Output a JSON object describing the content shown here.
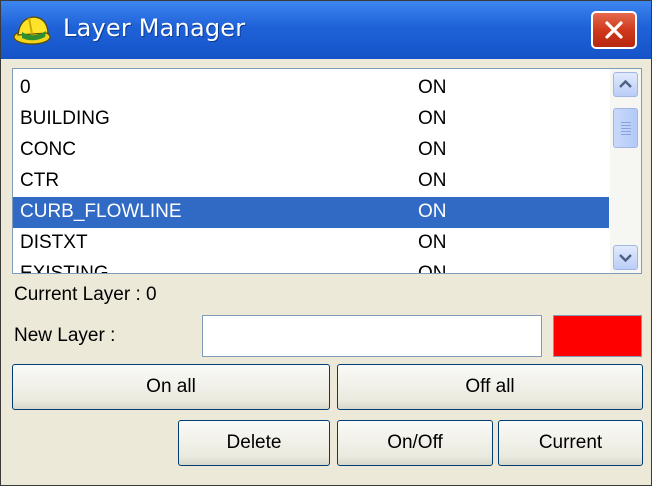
{
  "window": {
    "title": "Layer Manager",
    "icons": {
      "app": "hardhat-icon",
      "close": "close-icon"
    }
  },
  "layers": [
    {
      "name": "0",
      "state": "ON",
      "selected": false
    },
    {
      "name": "BUILDING",
      "state": "ON",
      "selected": false
    },
    {
      "name": "CONC",
      "state": "ON",
      "selected": false
    },
    {
      "name": "CTR",
      "state": "ON",
      "selected": false
    },
    {
      "name": "CURB_FLOWLINE",
      "state": "ON",
      "selected": true
    },
    {
      "name": "DISTXT",
      "state": "ON",
      "selected": false
    },
    {
      "name": "EXISTING",
      "state": "ON",
      "selected": false
    }
  ],
  "current_layer": {
    "label": "Current Layer :",
    "value": "0"
  },
  "new_layer": {
    "label": "New Layer :",
    "value": "",
    "color": "#ff0000"
  },
  "buttons": {
    "on_all": "On all",
    "off_all": "Off all",
    "delete": "Delete",
    "on_off": "On/Off",
    "current": "Current"
  },
  "colors": {
    "titlebar": "#1f62d8",
    "selection": "#316ac5",
    "close": "#d0391b"
  }
}
